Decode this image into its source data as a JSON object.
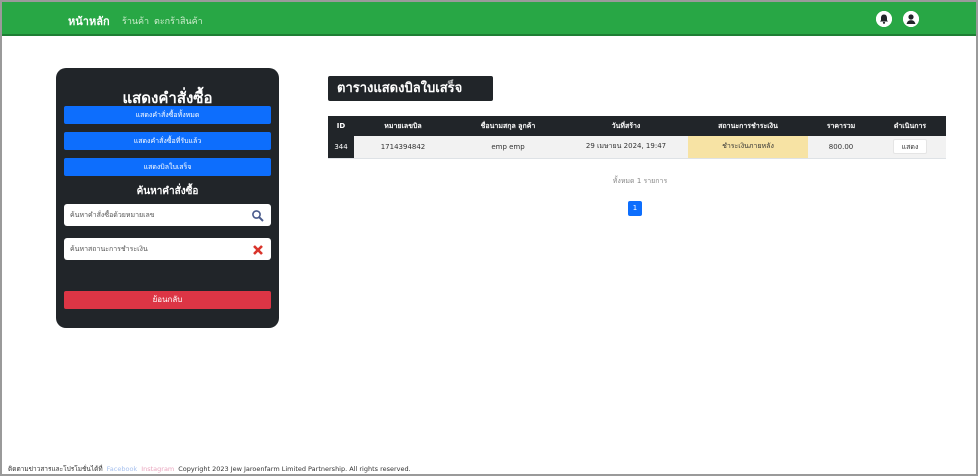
{
  "colors": {
    "navbar": "#28a745",
    "sidebar": "#212529",
    "primary_button": "#0d6efd",
    "danger_button": "#dc3545",
    "status_highlight": "#f7e3a4",
    "facebook_link": "#a6c0ee",
    "instagram_link": "#e9a4bd"
  },
  "navbar": {
    "brand": "หน้าหลัก",
    "links": [
      "ร้านค้า",
      "ตะกร้าสินค้า"
    ],
    "icons": [
      "bell-icon",
      "user-icon"
    ]
  },
  "sidebar": {
    "title": "แสดงคำสั่งซื้อ",
    "buttons": [
      "แสดงคำสั่งซื้อทั้งหมด",
      "แสดงคำสั่งซื้อที่รับแล้ว",
      "แสดงบิลใบเสร็จ"
    ],
    "search_title": "ค้นหาคำสั่งซื้อ",
    "search_order_placeholder": "ค้นหาคำสั่งซื้อด้วยหมายเลข",
    "search_status_placeholder": "ค้นหาสถานะการชำระเงิน",
    "back_button": "ย้อนกลับ"
  },
  "main": {
    "title": "ตารางแสดงบิลใบเสร็จ",
    "columns": [
      "ID",
      "หมายเลขบิล",
      "ชื่อนามสกุล ลูกค้า",
      "วันที่สร้าง",
      "สถานะการชำระเงิน",
      "ราคารวม",
      "ดำเนินการ"
    ],
    "rows": [
      {
        "id": "344",
        "bill_number": "1714394842",
        "customer": "emp emp",
        "created": "29 เมษายน 2024, 19:47",
        "status": "ชำระเงินภายหลัง",
        "total": "800.00",
        "action": "แสดง"
      }
    ],
    "total_records": "ทั้งหมด 1 รายการ",
    "current_page": "1"
  },
  "footer": {
    "contact_text": "ติดตามข่าวสารและโปรโมชั่นได้ที่",
    "facebook": "Facebook",
    "instagram": "Instagram",
    "copyright": "Copyright 2023 Jew Jaroenfarm Limited Partnership. All rights reserved."
  }
}
